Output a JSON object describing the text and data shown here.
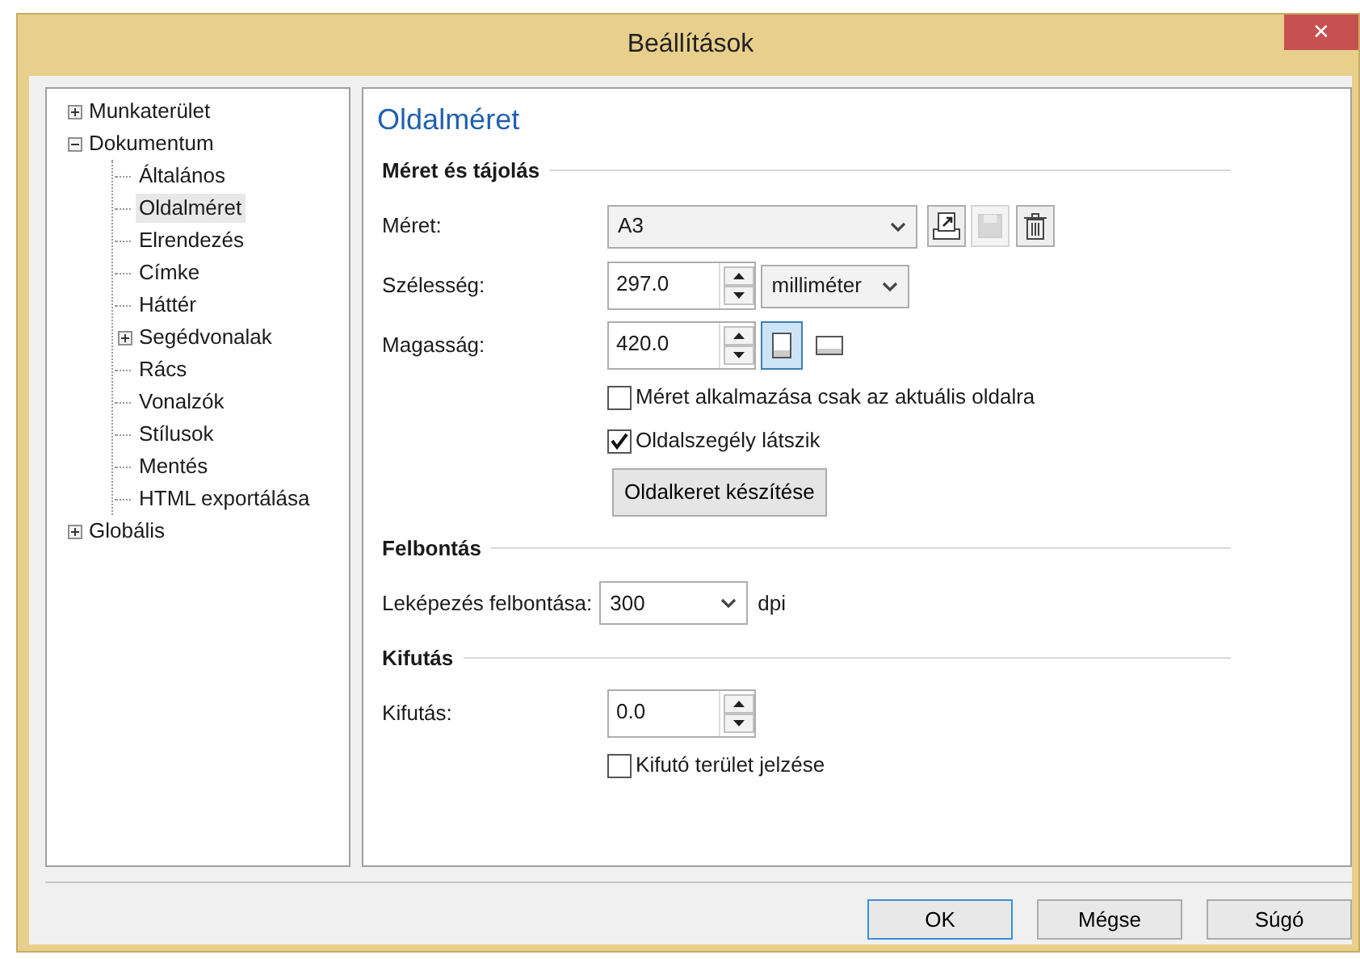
{
  "window": {
    "title": "Beállítások",
    "close": "✕"
  },
  "tree": [
    {
      "label": "Munkaterület",
      "expanded": false,
      "selected": false
    },
    {
      "label": "Dokumentum",
      "expanded": true,
      "selected": false,
      "children": [
        {
          "label": "Általános",
          "selected": false
        },
        {
          "label": "Oldalméret",
          "selected": true
        },
        {
          "label": "Elrendezés",
          "selected": false
        },
        {
          "label": "Címke",
          "selected": false
        },
        {
          "label": "Háttér",
          "selected": false
        },
        {
          "label": "Segédvonalak",
          "expanded": false,
          "selected": false
        },
        {
          "label": "Rács",
          "selected": false
        },
        {
          "label": "Vonalzók",
          "selected": false
        },
        {
          "label": "Stílusok",
          "selected": false
        },
        {
          "label": "Mentés",
          "selected": false
        },
        {
          "label": "HTML exportálása",
          "selected": false
        }
      ]
    },
    {
      "label": "Globális",
      "expanded": false,
      "selected": false
    }
  ],
  "panel": {
    "title": "Oldalméret",
    "sections": [
      {
        "title": "Méret és tájolás",
        "rows": [
          {
            "kind": "select",
            "label": "Méret:",
            "value": "A3",
            "wide": true,
            "tools": [
              {
                "kind": "import",
                "disabled": false
              },
              {
                "kind": "save",
                "disabled": true
              },
              {
                "kind": "delete",
                "disabled": false
              }
            ]
          },
          {
            "kind": "spin",
            "label": "Szélesség:",
            "value": "297.0",
            "unit_select": "milliméter"
          },
          {
            "kind": "spin",
            "label": "Magasság:",
            "value": "420.0",
            "orientations": [
              {
                "kind": "portrait",
                "selected": true
              },
              {
                "kind": "landscape",
                "selected": false
              }
            ]
          },
          {
            "kind": "checkbox",
            "label": "Méret alkalmazása csak az aktuális oldalra",
            "checked": false
          },
          {
            "kind": "checkbox",
            "label": "Oldalszegély látszik",
            "checked": true
          },
          {
            "kind": "button",
            "label": "Oldalkeret készítése"
          }
        ]
      },
      {
        "title": "Felbontás",
        "rows": [
          {
            "kind": "select",
            "label": "Leképezés felbontása:",
            "value": "300",
            "wide": false,
            "suffix": "dpi"
          }
        ]
      },
      {
        "title": "Kifutás",
        "rows": [
          {
            "kind": "spin",
            "label": "Kifutás:",
            "value": "0.0"
          },
          {
            "kind": "checkbox",
            "label": "Kifutó terület jelzése",
            "checked": false
          }
        ]
      }
    ]
  },
  "buttons": [
    {
      "label": "OK",
      "default": true
    },
    {
      "label": "Mégse",
      "default": false
    },
    {
      "label": "Súgó",
      "default": false
    }
  ]
}
